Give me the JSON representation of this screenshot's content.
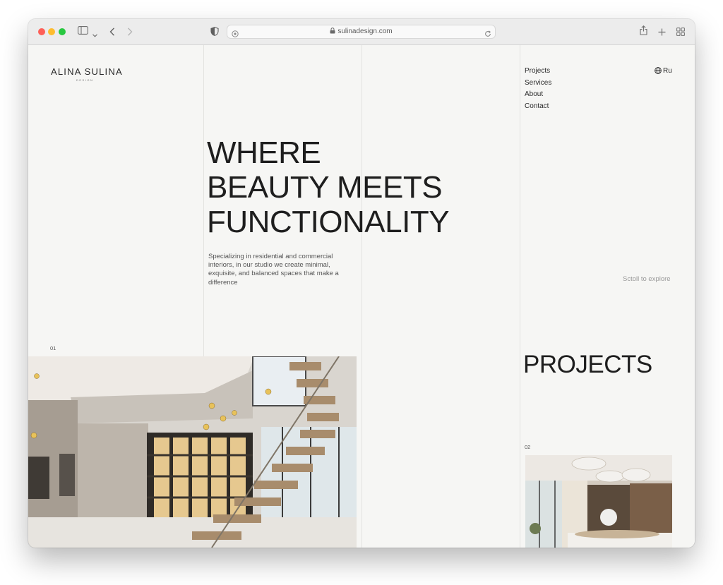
{
  "browser": {
    "url": "sulinadesign.com"
  },
  "site": {
    "logo": "ALINA SULINA",
    "logo_sub": "DESIGN",
    "nav": [
      "Projects",
      "Services",
      "About",
      "Contact"
    ],
    "language": "Ru",
    "hero_lines": [
      "WHERE",
      "BEAUTY MEETS",
      "FUNCTIONALITY"
    ],
    "description": "Specializing in residential and commercial interiors, in our studio we create minimal, exquisite, and balanced spaces that make a difference",
    "scroll_hint": "Sctoll to explore",
    "projects_heading": "PROJECTS",
    "project_numbers": [
      "01",
      "02"
    ]
  },
  "colors": {
    "page_bg": "#f6f6f4",
    "text": "#1e1e1e",
    "muted": "#9a9a9a"
  },
  "icons": {
    "language": "globe-icon",
    "share": "share-icon",
    "new_tab": "plus-icon",
    "tabs": "tab-overview-icon"
  }
}
